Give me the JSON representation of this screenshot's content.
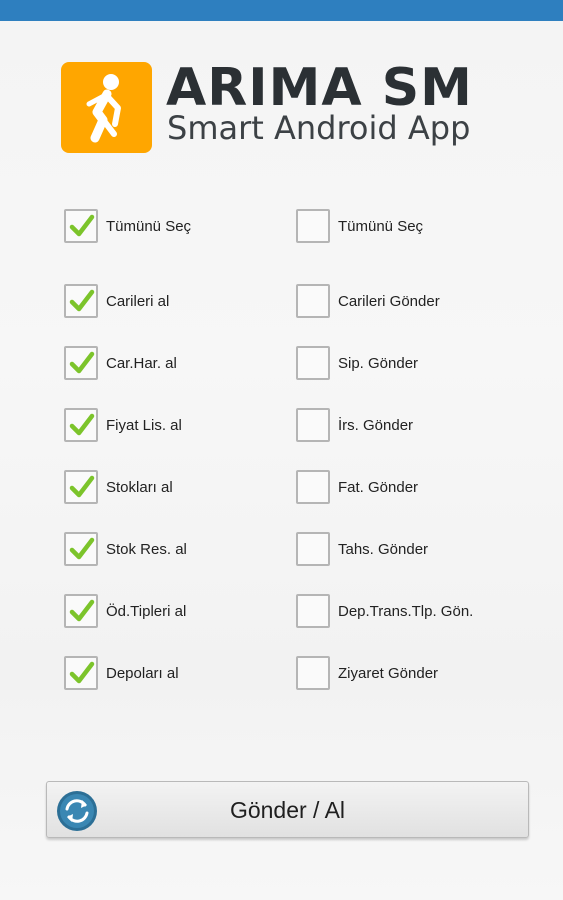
{
  "header": {
    "logo_icon": "running-man-icon",
    "title": "ARIMA SM",
    "subtitle": "Smart Android App",
    "accent_color": "#ffa600",
    "statusbar_color": "#2e7fbf"
  },
  "left_column": [
    {
      "label": "Tümünü Seç",
      "checked": true
    },
    {
      "label": "Carileri al",
      "checked": true
    },
    {
      "label": "Car.Har. al",
      "checked": true
    },
    {
      "label": "Fiyat Lis. al",
      "checked": true
    },
    {
      "label": "Stokları al",
      "checked": true
    },
    {
      "label": "Stok Res. al",
      "checked": true
    },
    {
      "label": "Öd.Tipleri al",
      "checked": true
    },
    {
      "label": "Depoları al",
      "checked": true
    }
  ],
  "right_column": [
    {
      "label": "Tümünü Seç",
      "checked": false
    },
    {
      "label": "Carileri Gönder",
      "checked": false
    },
    {
      "label": "Sip. Gönder",
      "checked": false
    },
    {
      "label": "İrs. Gönder",
      "checked": false
    },
    {
      "label": "Fat. Gönder",
      "checked": false
    },
    {
      "label": "Tahs. Gönder",
      "checked": false
    },
    {
      "label": "Dep.Trans.Tlp. Gön.",
      "checked": false
    },
    {
      "label": "Ziyaret Gönder",
      "checked": false
    }
  ],
  "sync_button": {
    "label": "Gönder / Al",
    "icon": "sync-icon"
  }
}
